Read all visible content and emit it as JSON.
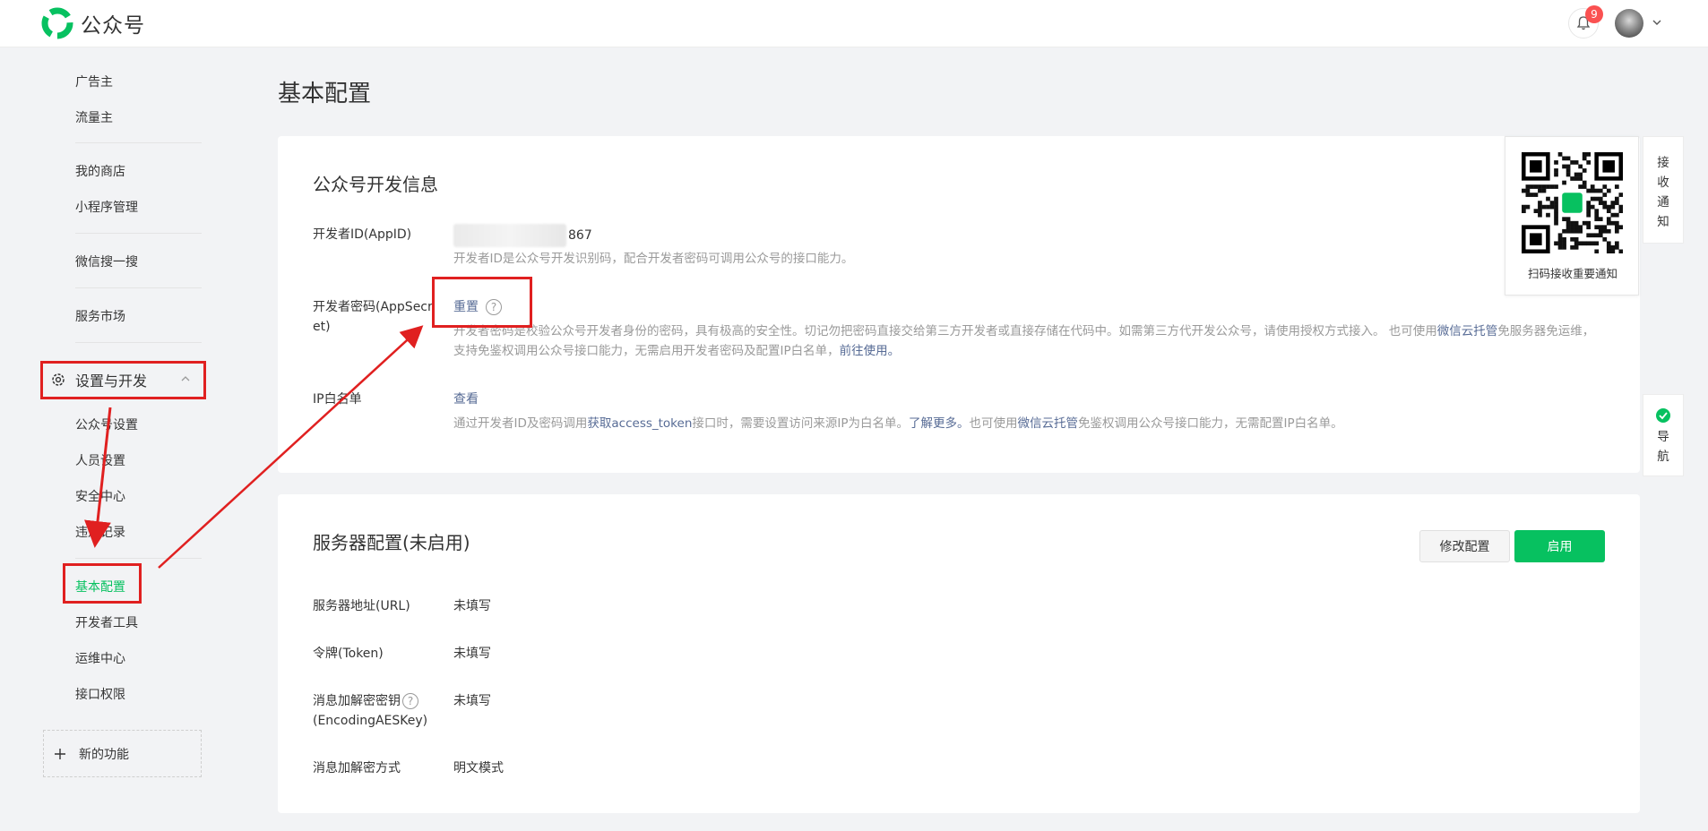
{
  "header": {
    "app_name": "公众号",
    "notifications_count": "9"
  },
  "sidebar": {
    "items_top": [
      "广告主",
      "流量主",
      "我的商店",
      "小程序管理",
      "微信搜一搜",
      "服务市场"
    ],
    "section_title": "设置与开发",
    "section_items": [
      "公众号设置",
      "人员设置",
      "安全中心",
      "违规记录",
      "基本配置",
      "开发者工具",
      "运维中心",
      "接口权限"
    ],
    "active_item": "基本配置",
    "new_features_label": "新的功能"
  },
  "page": {
    "title": "基本配置"
  },
  "dev_info": {
    "title": "公众号开发信息",
    "appid_label": "开发者ID(AppID)",
    "appid_value_suffix": "867",
    "appid_desc": "开发者ID是公众号开发识别码，配合开发者密码可调用公众号的接口能力。",
    "secret_label": "开发者密码(AppSecret)",
    "secret_action": "重置",
    "secret_help": "?",
    "secret_desc_1": "开发者密码是校验公众号开发者身份的密码，具有极高的安全性。切记勿把密码直接交给第三方开发者或直接存储在代码中。如需第三方代开发公众号，请使用授权方式接入。 也可使用",
    "secret_desc_link1": "微信云托管",
    "secret_desc_2": "免服务器免运维，支持免鉴权调用公众号接口能力，无需启用开发者密码及配置IP白名单，",
    "secret_desc_link2": "前往使用。",
    "ip_label": "IP白名单",
    "ip_action": "查看",
    "ip_desc_1": "通过开发者ID及密码调用",
    "ip_desc_link1": "获取access_token",
    "ip_desc_2": "接口时，需要设置访问来源IP为白名单。",
    "ip_desc_link2": "了解更多。",
    "ip_desc_3": "也可使用",
    "ip_desc_link3": "微信云托管",
    "ip_desc_4": "免鉴权调用公众号接口能力，无需配置IP白名单。"
  },
  "server_config": {
    "title": "服务器配置(未启用)",
    "modify_button": "修改配置",
    "enable_button": "启用",
    "url_label": "服务器地址(URL)",
    "url_value": "未填写",
    "token_label": "令牌(Token)",
    "token_value": "未填写",
    "aes_label_1": "消息加解密密钥",
    "aes_label_2": "(EncodingAESKey)",
    "aes_help": "?",
    "aes_value": "未填写",
    "mode_label": "消息加解密方式",
    "mode_value": "明文模式"
  },
  "float": {
    "qr_caption": "扫码接收重要通知",
    "notify_tab": "接收通知",
    "nav_tab": "导航"
  },
  "colors": {
    "brand_green": "#07c160",
    "link": "#576b95",
    "annotation_red": "#e02020"
  }
}
